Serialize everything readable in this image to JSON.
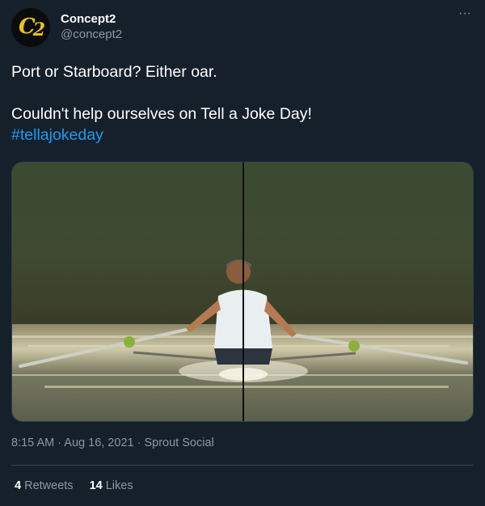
{
  "author": {
    "display_name": "Concept2",
    "handle": "@concept2",
    "avatar_logo": "C2"
  },
  "more_icon": "more-horizontal-icon",
  "tweet": {
    "line1": "Port or Starboard? Either oar.",
    "line2": "Couldn't help ourselves on Tell a Joke Day!",
    "hashtag": "#tellajokeday"
  },
  "meta": {
    "time": "8:15 AM",
    "separator1": " · ",
    "date": "Aug 16, 2021",
    "separator2": " · ",
    "source": "Sprout Social"
  },
  "stats": {
    "retweets_count": "4",
    "retweets_label": "Retweets",
    "likes_count": "14",
    "likes_label": "Likes"
  },
  "colors": {
    "background": "#15202b",
    "link": "#1d9bf0",
    "muted": "#8b98a5",
    "logo_gold": "#e8c31a"
  }
}
